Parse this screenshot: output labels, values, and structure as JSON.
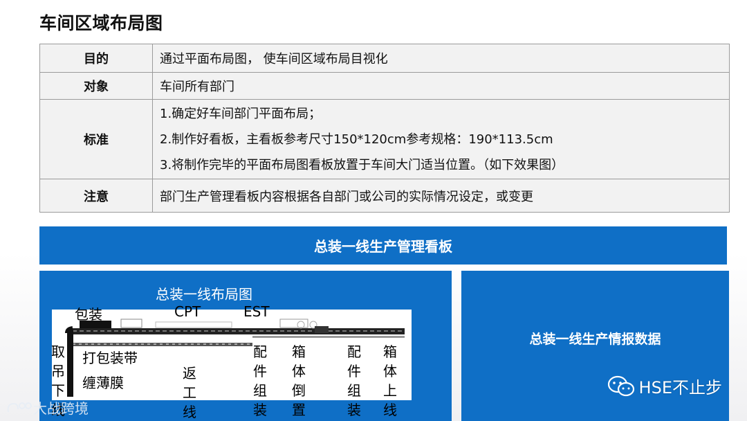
{
  "page": {
    "title": "车间区域布局图"
  },
  "table": {
    "rows": [
      {
        "label": "目的",
        "content": "通过平面布局图， 使车间区域布局目视化"
      },
      {
        "label": "对象",
        "content": "车间所有部门"
      },
      {
        "label": "标准",
        "lines": [
          "1.确定好车间部门平面布局；",
          "2.制作好看板，主看板参考尺寸150*120cm参考规格：190*113.5cm",
          "3.将制作完毕的平面布局图看板放置于车间大门适当位置。（如下效果图）"
        ]
      },
      {
        "label": "注意",
        "content": "部门生产管理看板内容根据各自部门或公司的实际情况设定，或变更"
      }
    ]
  },
  "board": {
    "banner": "总装一线生产管理看板",
    "layout_title": "总装一线布局图",
    "info_title": "总装一线生产情报数据",
    "labels": {
      "pack": "包装",
      "cpt": "CPT",
      "est": "EST",
      "lift": "取吊下线",
      "strap": "打包装带",
      "film": "缠薄膜",
      "return": "返工线",
      "assy1": "配件组装",
      "invert": "箱体倒置",
      "assy2": "配件组装",
      "online": "箱体上线"
    }
  },
  "watermark": {
    "text": "HSE不止步",
    "corner": "大战跨境"
  },
  "colors": {
    "panel_blue": "#0f6fc6",
    "table_bg": "#f2f2f2",
    "border": "#9a9a9a"
  }
}
